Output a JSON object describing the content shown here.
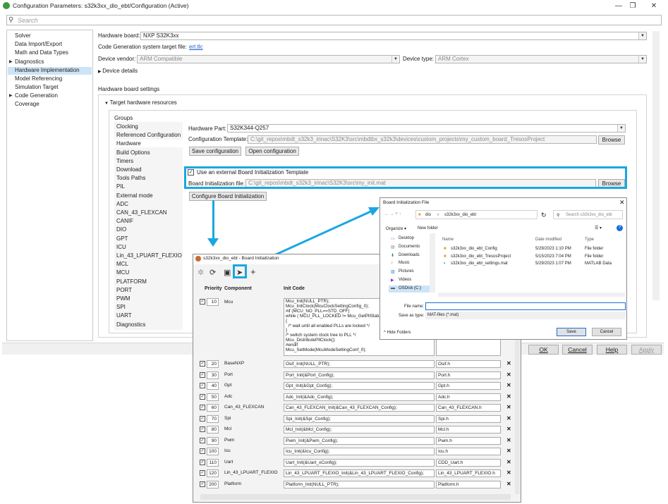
{
  "window": {
    "title": "Configuration Parameters: s32k3xx_dio_ebt/Configuration (Active)",
    "minimize": "—",
    "restore": "❐",
    "close": "✕"
  },
  "search": {
    "placeholder": "Search",
    "icon": "search-icon"
  },
  "tree": {
    "items": [
      {
        "label": "Solver",
        "arrow": ""
      },
      {
        "label": "Data Import/Export",
        "arrow": ""
      },
      {
        "label": "Math and Data Types",
        "arrow": ""
      },
      {
        "label": "Diagnostics",
        "arrow": "▶"
      },
      {
        "label": "Hardware Implementation",
        "arrow": "",
        "selected": true
      },
      {
        "label": "Model Referencing",
        "arrow": ""
      },
      {
        "label": "Simulation Target",
        "arrow": ""
      },
      {
        "label": "Code Generation",
        "arrow": "▶"
      },
      {
        "label": "Coverage",
        "arrow": ""
      }
    ]
  },
  "main": {
    "hardware_board_label": "Hardware board:",
    "hardware_board_value": "NXP S32K3xx",
    "codegen_target_label": "Code Generation system target file:",
    "codegen_target_link": "ert.tlc",
    "device_vendor_label": "Device vendor:",
    "device_vendor_value": "ARM Compatible",
    "device_type_label": "Device type:",
    "device_type_value": "ARM Cortex",
    "device_details": "Device details",
    "board_settings_heading": "Hardware board settings",
    "target_resources": "Target hardware resources",
    "groups_label": "Groups",
    "groups": [
      "Clocking",
      "Referenced Configuration",
      "Hardware",
      "Build Options",
      "Timers",
      "Download",
      "Tools Paths",
      "PIL",
      "External mode",
      "ADC",
      "CAN_43_FLEXCAN",
      "CANIF",
      "DIO",
      "GPT",
      "ICU",
      "Lin_43_LPUART_FLEXIO",
      "MCL",
      "MCU",
      "PLATFORM",
      "PORT",
      "PWM",
      "SPI",
      "UART",
      "Diagnostics"
    ],
    "selected_group": "Hardware",
    "hardware_part_label": "Hardware Part:",
    "hardware_part_value": "S32K344-Q257",
    "config_template_label": "Configuration Template:",
    "config_template_value": "C:\\git_repos\\mbdt_s32k3_irinac\\S32K3\\src\\mbdtbx_s32k3\\devices\\custom_projects\\my_custom_board_TresosProject",
    "browse": "Browse",
    "save_configuration": "Save configuration",
    "open_configuration": "Open configuration",
    "use_external_label": "Use an external Board Initialization Template",
    "board_init_file_label": "Board Initialization file:",
    "board_init_file_value": "C:\\git_repos\\mbdt_s32k3_irinac\\S32K3\\src\\my_init.mat",
    "configure_board_init": "Configure Board Initialization"
  },
  "dialog_buttons": {
    "ok": "OK",
    "cancel": "Cancel",
    "help": "Help",
    "apply": "Apply"
  },
  "board_init": {
    "title": "s32k3xx_dio_ebt - Board Initialization",
    "col_priority": "Priority",
    "col_component": "Component",
    "col_init_code": "Init Code",
    "mcu": {
      "priority": "10",
      "component": "Mcu",
      "code_lines": [
        "Mcu_Init(NULL_PTR);",
        "Mcu_InitClock(McuClockSettingConfig_0);",
        "#if (MCU_NO_PLL==STD_OFF)",
        "while ( MCU_PLL_LOCKED != Mcu_GetPllStatus",
        "{",
        "  /* wait until all enabled PLLs are locked */",
        "}",
        "/* switch system clock tree to PLL */",
        "Mcu_DistributePllClock();",
        "#endif",
        "Mcu_SetMode(McuModeSettingConf_0);"
      ]
    },
    "rows": [
      {
        "priority": "20",
        "component": "BaseNXP",
        "code": "Osif_Init(NULL_PTR);",
        "header": "Osif.h"
      },
      {
        "priority": "30",
        "component": "Port",
        "code": "Port_Init(&Port_Config);",
        "header": "Port.h"
      },
      {
        "priority": "40",
        "component": "Gpt",
        "code": "Gpt_Init(&Gpt_Config);",
        "header": "Gpt.h"
      },
      {
        "priority": "50",
        "component": "Adc",
        "code": "Adc_Init(&Adc_Config);",
        "header": "Adc.h"
      },
      {
        "priority": "60",
        "component": "Can_43_FLEXCAN",
        "code": "Can_43_FLEXCAN_Init(&Can_43_FLEXCAN_Config);",
        "header": "Can_43_FLEXCAN.h"
      },
      {
        "priority": "70",
        "component": "Spi",
        "code": "Spi_Init(&Spi_Config);",
        "header": "Spi.h"
      },
      {
        "priority": "80",
        "component": "Mcl",
        "code": "Mcl_Init(&Mcl_Config);",
        "header": "Mcl.h"
      },
      {
        "priority": "90",
        "component": "Pwm",
        "code": "Pwm_Init(&Pwm_Config);",
        "header": "Pwm.h"
      },
      {
        "priority": "100",
        "component": "Icu",
        "code": "Icu_Init(&Icu_Config);",
        "header": "Icu.h"
      },
      {
        "priority": "110",
        "component": "Uart",
        "code": "Uart_Init(&Uart_xConfig);",
        "header": "CDD_Uart.h"
      },
      {
        "priority": "120",
        "component": "Lin_43_LPUART_FLEXIO",
        "code": "Lin_43_LPUART_FLEXIO_Init(&Lin_43_LPUART_FLEXIO_Config);",
        "header": "Lin_43_LPUART_FLEXIO.h"
      },
      {
        "priority": "200",
        "component": "Platform",
        "code": "Platform_Init(NULL_PTR);",
        "header": "Platform.h"
      }
    ]
  },
  "file_dialog": {
    "title": "Board Initialization File",
    "path": [
      "dio",
      "s32k3xx_dio_ebt"
    ],
    "search_placeholder": "Search s32k3xx_dio_ebt",
    "organize": "Organize ▾",
    "new_folder": "New folder",
    "nav": [
      "Desktop",
      "Documents",
      "Downloads",
      "Music",
      "Pictures",
      "Videos",
      "OSDisk (C:)"
    ],
    "columns": {
      "name": "Name",
      "date": "Date modified",
      "type": "Type"
    },
    "files": [
      {
        "name": "s32k3xx_dio_ebt_Config",
        "date": "5/29/2023 1:10 PM",
        "type": "File folder"
      },
      {
        "name": "s32k3xx_dio_ebt_TresosProject",
        "date": "5/15/2023 7:04 PM",
        "type": "File folder"
      },
      {
        "name": "s32k3xx_dio_ebt_settings.mat",
        "date": "5/29/2023 1:07 PM",
        "type": "MATLAB Data"
      }
    ],
    "file_name_label": "File name:",
    "save_as_label": "Save as type:",
    "save_as_value": "MAT-files (*.mat)",
    "hide_folders": "Hide Folders",
    "save": "Save",
    "cancel": "Cancel"
  },
  "colors": {
    "highlight": "#1aa7e0",
    "selection": "#cce4f7"
  }
}
